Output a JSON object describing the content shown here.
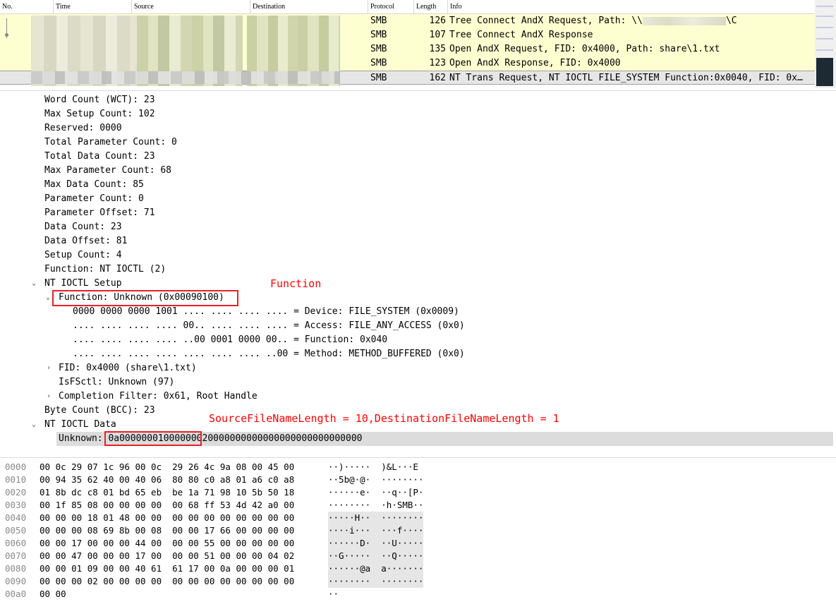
{
  "packet_list": {
    "columns": [
      "No.",
      "Time",
      "Source",
      "Destination",
      "Protocol",
      "Length",
      "Info"
    ],
    "rows": [
      {
        "protocol": "SMB",
        "length": "126",
        "info": "Tree Connect AndX Request, Path: \\\\",
        "info_tail": "\\C",
        "selected": false
      },
      {
        "protocol": "SMB",
        "length": "107",
        "info": "Tree Connect AndX Response",
        "info_tail": "",
        "selected": false
      },
      {
        "protocol": "SMB",
        "length": "135",
        "info": "Open AndX Request, FID: 0x4000, Path: share\\1.txt",
        "info_tail": "",
        "selected": false
      },
      {
        "protocol": "SMB",
        "length": "123",
        "info": "Open AndX Response, FID: 0x4000",
        "info_tail": "",
        "selected": false
      },
      {
        "protocol": "SMB",
        "length": "162",
        "info": "NT Trans Request, NT IOCTL FILE_SYSTEM Function:0x0040, FID: 0x…",
        "info_tail": "",
        "selected": true
      }
    ]
  },
  "details": {
    "lines": [
      "Word Count (WCT): 23",
      "Max Setup Count: 102",
      "Reserved: 0000",
      "Total Parameter Count: 0",
      "Total Data Count: 23",
      "Max Parameter Count: 68",
      "Max Data Count: 85",
      "Parameter Count: 0",
      "Parameter Offset: 71",
      "Data Count: 23",
      "Data Offset: 81",
      "Setup Count: 4",
      "Function: NT IOCTL (2)"
    ],
    "ioctl_setup_label": "NT IOCTL Setup",
    "function_label": "Function: Unknown (0x00090100)",
    "bitfields": [
      "0000 0000 0000 1001 .... .... .... .... = Device: FILE_SYSTEM (0x0009)",
      ".... .... .... .... 00.. .... .... .... = Access: FILE_ANY_ACCESS (0x0)",
      ".... .... .... .... ..00 0001 0000 00.. = Function: 0x040",
      ".... .... .... .... .... .... .... ..00 = Method: METHOD_BUFFERED (0x0)"
    ],
    "fid_label": "FID: 0x4000 (share\\1.txt)",
    "isfsctl_label": "IsFSctl: Unknown (97)",
    "completion_label": "Completion Filter: 0x61, Root Handle",
    "byte_count_label": "Byte Count (BCC): 23",
    "ioctl_data_label": "NT IOCTL Data",
    "unknown_label": "Unknown: ",
    "unknown_value": "0a00000001000000020000000000000000000000000000",
    "annotation_function": "Function",
    "annotation_lengths": "SourceFileNameLength = 10,DestinationFileNameLength = 1"
  },
  "hex_dump": [
    {
      "offset": "0000",
      "bytes": "00 0c 29 07 1c 96 00 0c  29 26 4c 9a 08 00 45 00",
      "ascii": "··)·····  )&L···E"
    },
    {
      "offset": "0010",
      "bytes": "00 94 35 62 40 00 40 06  80 80 c0 a8 01 a6 c0 a8",
      "ascii": "··5b@·@·  ········"
    },
    {
      "offset": "0020",
      "bytes": "01 8b dc c8 01 bd 65 eb  be 1a 71 98 10 5b 50 18",
      "ascii": "······e·  ··q··[P·"
    },
    {
      "offset": "0030",
      "bytes": "00 1f 85 08 00 00 00 00  00 68 ff 53 4d 42 a0 00",
      "ascii": "········  ·h·SMB··"
    },
    {
      "offset": "0040",
      "bytes": "00 00 00 18 01 48 00 00  00 00 00 00 00 00 00 00",
      "ascii": "·····H··  ········"
    },
    {
      "offset": "0050",
      "bytes": "00 00 00 08 69 8b 00 08  00 00 17 66 00 00 00 00",
      "ascii": "····i···  ···f····"
    },
    {
      "offset": "0060",
      "bytes": "00 00 17 00 00 00 44 00  00 00 55 00 00 00 00 00",
      "ascii": "······D·  ··U·····"
    },
    {
      "offset": "0070",
      "bytes": "00 00 47 00 00 00 17 00  00 00 51 00 00 00 04 02",
      "ascii": "··G·····  ··Q·····"
    },
    {
      "offset": "0080",
      "bytes": "00 00 01 09 00 00 40 61  61 17 00 0a 00 00 00 01",
      "ascii": "······@a  a·······"
    },
    {
      "offset": "0090",
      "bytes": "00 00 00 02 00 00 00 00  00 00 00 00 00 00 00 00",
      "ascii": "········  ········"
    },
    {
      "offset": "00a0",
      "bytes": "00 00",
      "ascii": "··"
    }
  ],
  "colors": {
    "row_bg": "#feffd0",
    "selected_row_bg": "#e6e6e6",
    "annotation": "#ff0000",
    "scroll_thumb": "#1e2a33"
  },
  "icons": [
    "tree-expanded-arrow-icon",
    "tree-collapsed-arrow-icon",
    "related-packet-dot-icon"
  ]
}
